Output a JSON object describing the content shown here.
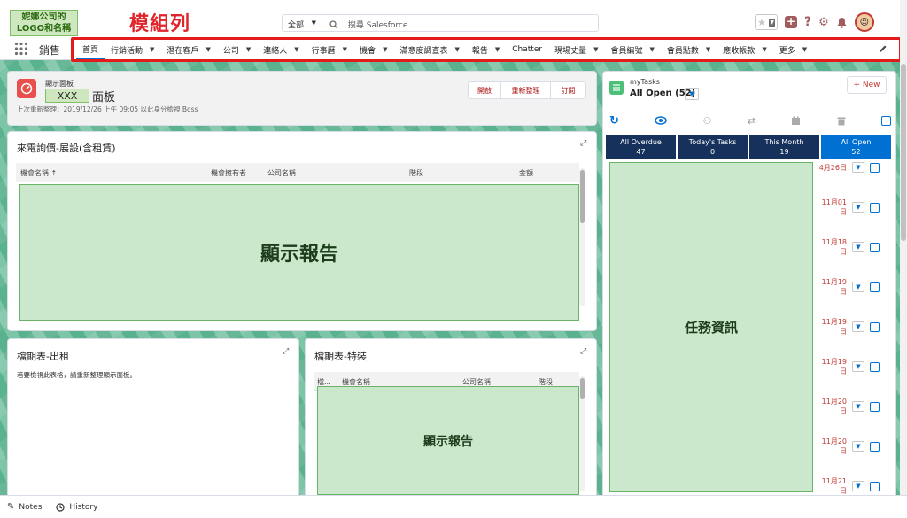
{
  "header": {
    "logo_line1": "妮娜公司的",
    "logo_line2": "LOGO和名稱",
    "annotation_title": "模組列",
    "search_scope": "全部",
    "search_placeholder": "搜尋 Salesforce"
  },
  "nav": {
    "app_name": "銷售",
    "items": [
      {
        "label": "首頁",
        "has_menu": false
      },
      {
        "label": "行銷活動",
        "has_menu": true
      },
      {
        "label": "潛在客戶",
        "has_menu": true
      },
      {
        "label": "公司",
        "has_menu": true
      },
      {
        "label": "連絡人",
        "has_menu": true
      },
      {
        "label": "行事曆",
        "has_menu": true
      },
      {
        "label": "機會",
        "has_menu": true
      },
      {
        "label": "滿意度調查表",
        "has_menu": true
      },
      {
        "label": "報告",
        "has_menu": true
      },
      {
        "label": "Chatter",
        "has_menu": false
      },
      {
        "label": "現場丈量",
        "has_menu": true
      },
      {
        "label": "會員編號",
        "has_menu": true
      },
      {
        "label": "會員點數",
        "has_menu": true
      },
      {
        "label": "應收帳款",
        "has_menu": true
      },
      {
        "label": "更多",
        "has_menu": true
      }
    ]
  },
  "dashboard": {
    "kicker": "顯示面板",
    "name_box": "XXX",
    "title_suffix": "面板",
    "refresh_info": "上次重新整理：2019/12/26 上午 09:05 以此身分檢視 Boss",
    "buttons": {
      "open": "開啟",
      "refresh": "重新整理",
      "subscribe": "訂閱"
    }
  },
  "report1": {
    "title": "來電詢價-展設(含租賃)",
    "columns": [
      "機會名稱 ↑",
      "機會擁有者",
      "公司名稱",
      "階段",
      "金額"
    ],
    "overlay": "顯示報告"
  },
  "report2": {
    "title": "檔期表-出租",
    "message": "若要檢視此表格，請重新整理顯示面板。"
  },
  "report3": {
    "title": "檔期表-特裝",
    "columns": [
      "檔...",
      "機會名稱",
      "公司名稱",
      "階段"
    ],
    "overlay": "顯示報告"
  },
  "tasks": {
    "kicker": "myTasks",
    "view": "All Open (52)",
    "new_button": "+ New",
    "tabs": [
      {
        "label": "All Overdue",
        "count": "47"
      },
      {
        "label": "Today's Tasks",
        "count": "0"
      },
      {
        "label": "This Month",
        "count": "19"
      },
      {
        "label": "All Open",
        "count": "52"
      }
    ],
    "overlay": "任務資訊",
    "due_dates": [
      "4月26日",
      "11月01日",
      "11月18日",
      "11月19日",
      "11月19日",
      "11月19日",
      "11月20日",
      "11月20日",
      "11月21日"
    ]
  },
  "footer": {
    "notes": "Notes",
    "history": "History"
  },
  "colors": {
    "annotation_red": "#e31b1b",
    "brand_blue": "#0070d2",
    "navy": "#16325c",
    "overlay_green": "#c8e6c8"
  }
}
